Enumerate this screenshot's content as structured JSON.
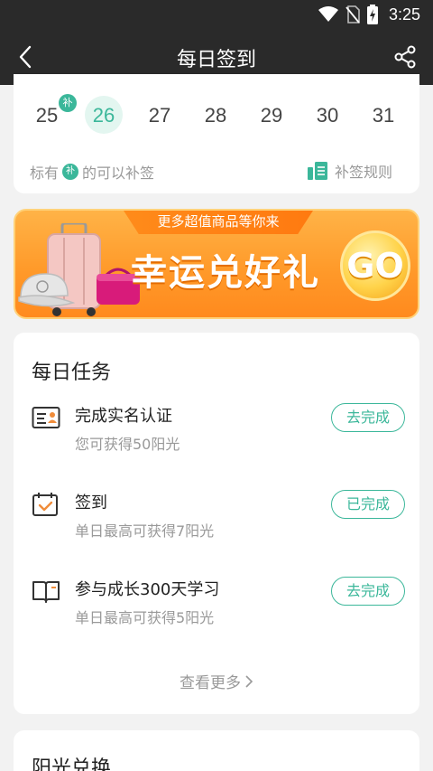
{
  "status_bar": {
    "time": "3:25",
    "icons": [
      "wifi-icon",
      "no-sim-icon",
      "battery-charging-icon"
    ]
  },
  "app_bar": {
    "title": "每日签到",
    "back_icon": "chevron-left-icon",
    "share_icon": "share-icon"
  },
  "calendar": {
    "dates": [
      {
        "day": "25",
        "badge": "补"
      },
      {
        "day": "26",
        "today": true
      },
      {
        "day": "27"
      },
      {
        "day": "28"
      },
      {
        "day": "29"
      },
      {
        "day": "30"
      },
      {
        "day": "31"
      }
    ],
    "legend_prefix": "标有",
    "legend_badge": "补",
    "legend_suffix": "的可以补签",
    "rules_label": "补签规则",
    "accent_color": "#3bb79a"
  },
  "banner": {
    "ribbon": "更多超值商品等你来",
    "headline": "幸运兑好礼",
    "go_label": "GO"
  },
  "tasks": {
    "title": "每日任务",
    "items": [
      {
        "icon": "id-card-icon",
        "name": "完成实名认证",
        "desc": "您可获得50阳光",
        "button": "去完成"
      },
      {
        "icon": "calendar-check-icon",
        "name": "签到",
        "desc": "单日最高可获得7阳光",
        "button": "已完成"
      },
      {
        "icon": "open-book-icon",
        "name": "参与成长300天学习",
        "desc": "单日最高可获得5阳光",
        "button": "去完成"
      }
    ],
    "see_more": "查看更多"
  },
  "bottom_section": {
    "title": "阳光兑换"
  }
}
